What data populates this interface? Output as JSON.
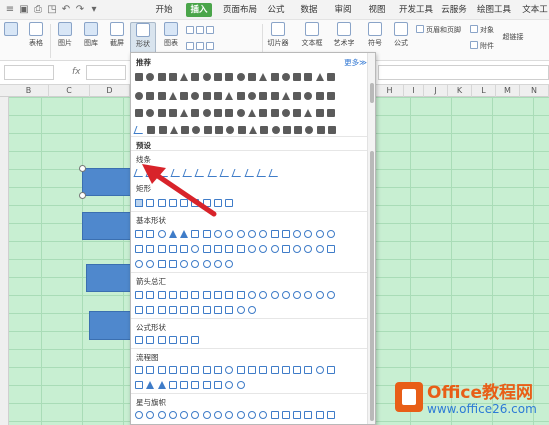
{
  "tabs": [
    "开始",
    "插入",
    "页面布局",
    "公式",
    "数据",
    "审阅",
    "视图",
    "开发工具",
    "云服务",
    "绘图工具",
    "文本工"
  ],
  "active_tab": "插入",
  "ribbon": {
    "table_label": "表格",
    "picture_label": "图片",
    "gallery_label": "图库",
    "screenshot_label": "截屏",
    "shapes_label": "形状",
    "chart_label": "图表",
    "textbox_label": "文本框",
    "art_label": "艺术字",
    "symbol_label": "符号",
    "formula_label": "公式",
    "slicer_label": "切片器",
    "header_footer_label": "页眉和页脚",
    "object_label": "对象",
    "attachment_label": "附件",
    "hyperlink_label": "超链接"
  },
  "formula_bar": {
    "fx": "fx"
  },
  "columns": [
    "B",
    "C",
    "D",
    "H",
    "I",
    "J",
    "K",
    "L",
    "M",
    "N"
  ],
  "panel": {
    "recommended": "推荐",
    "more": "更多≫",
    "preset": "预设",
    "lines": "线条",
    "rectangles": "矩形",
    "basic_shapes": "基本形状",
    "block_arrows": "箭头总汇",
    "equation_shapes": "公式形状",
    "flowchart": "流程图",
    "stars_banners": "星与旗帜"
  },
  "watermark": {
    "title": "Office教程网",
    "url": "www.office26.com"
  },
  "colors": {
    "accent": "#4aa54a",
    "sheet": "#c8efd2",
    "shape_fill": "#4f88cd",
    "arrow": "#d8232a"
  }
}
